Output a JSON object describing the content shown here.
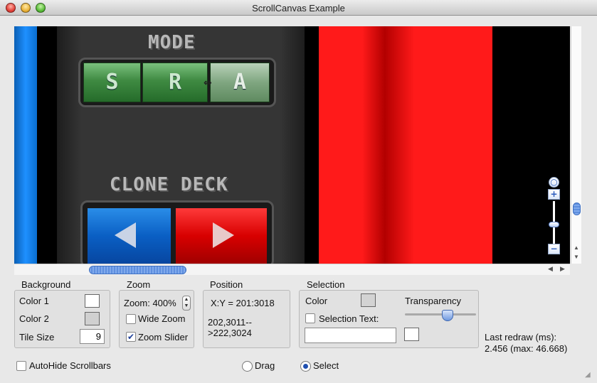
{
  "window": {
    "title": "ScrollCanvas Example"
  },
  "canvas": {
    "mode_label": "MODE",
    "mode_buttons": [
      "S",
      "R",
      "A"
    ],
    "clone_label": "CLONE DECK",
    "zoom_widget": {
      "reset": "○",
      "plus": "+",
      "minus": "−",
      "level": 0.55
    }
  },
  "scrollbars": {
    "vertical_up": "▲",
    "vertical_down": "▼",
    "left": "◀",
    "right": "▶"
  },
  "background": {
    "title": "Background",
    "color1_label": "Color 1",
    "color1": "#ffffff",
    "color2_label": "Color 2",
    "color2": "#d0d0d0",
    "tile_label": "Tile Size",
    "tile_value": "9"
  },
  "zoom": {
    "title": "Zoom",
    "zoom_text": "Zoom: 400%",
    "wide_zoom": "Wide Zoom",
    "wide_zoom_checked": false,
    "zoom_slider": "Zoom Slider",
    "zoom_slider_checked": true
  },
  "position": {
    "title": "Position",
    "xy": "X:Y = 201:3018",
    "range_line1": "202,3011--",
    "range_line2": ">222,3024"
  },
  "selection": {
    "title": "Selection",
    "color_label": "Color",
    "color": "#d3d3d3",
    "transparency_label": "Transparency",
    "transparency": 0.6,
    "selection_text_label": "Selection Text:",
    "selection_text_checked": false,
    "text_value": ""
  },
  "redraw": {
    "line1": "Last redraw (ms):",
    "line2": "2.456 (max: 46.668)"
  },
  "bottom": {
    "autohide_label": "AutoHide Scrollbars",
    "autohide_checked": false,
    "drag_label": "Drag",
    "select_label": "Select",
    "selected": "Select"
  }
}
